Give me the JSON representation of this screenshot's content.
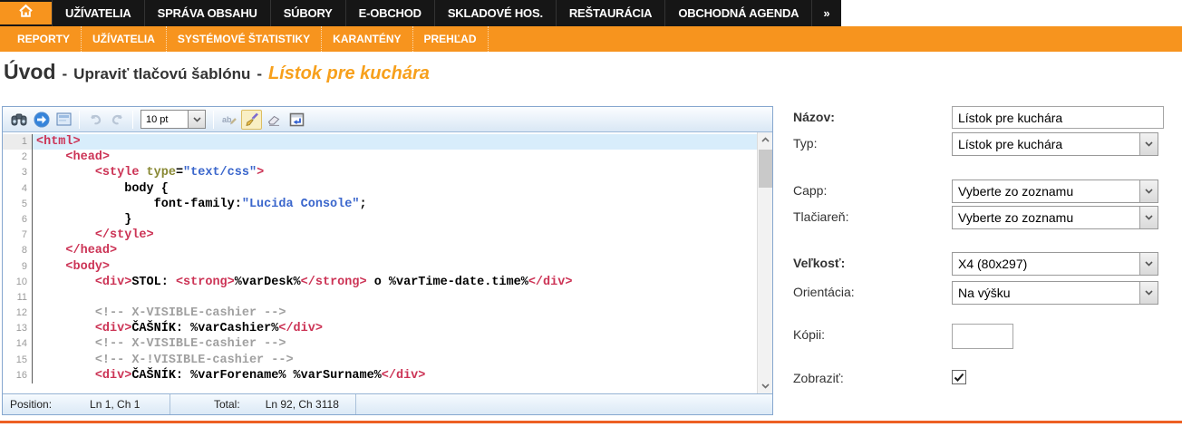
{
  "colors": {
    "orange": "#F7941E",
    "rule_orange": "#ED6023",
    "nav_black": "#161616",
    "tag_red": "#CC3355",
    "attr_olive": "#888833",
    "string_blue": "#3A66CC",
    "comment_gray": "#A0A0A0",
    "active_line_blue": "#D8EDFB"
  },
  "nav": {
    "home_icon": "home-icon",
    "items": [
      "UŽÍVATELIA",
      "SPRÁVA OBSAHU",
      "SÚBORY",
      "E-OBCHOD",
      "SKLADOVÉ HOS.",
      "REŠTAURÁCIA",
      "OBCHODNÁ AGENDA"
    ],
    "more": "»"
  },
  "subnav": {
    "items": [
      "REPORTY",
      "UŽÍVATELIA",
      "SYSTÉMOVÉ ŠTATISTIKY",
      "KARANTÉNY",
      "PREHĽAD"
    ]
  },
  "breadcrumb": {
    "root": "Úvod",
    "separator": "-",
    "section": "Upraviť tlačovú šablónu",
    "current": "Lístok pre kuchára"
  },
  "editor": {
    "toolbar": {
      "font_size": "10 pt",
      "icons": [
        "find",
        "goto-line",
        "select-all",
        "undo",
        "redo",
        "font-size-select",
        "replace",
        "format-brush",
        "eraser",
        "insert-template"
      ]
    },
    "lines": [
      {
        "no": 1,
        "active": true,
        "tokens": [
          {
            "t": "tag",
            "s": "<html>"
          }
        ]
      },
      {
        "no": 2,
        "tokens": [
          {
            "t": "text",
            "s": "    "
          },
          {
            "t": "tag",
            "s": "<head>"
          }
        ]
      },
      {
        "no": 3,
        "tokens": [
          {
            "t": "text",
            "s": "        "
          },
          {
            "t": "tag",
            "s": "<style"
          },
          {
            "t": "text",
            "s": " "
          },
          {
            "t": "attr",
            "s": "type"
          },
          {
            "t": "text",
            "s": "="
          },
          {
            "t": "str",
            "s": "\"text/css\""
          },
          {
            "t": "tag",
            "s": ">"
          }
        ]
      },
      {
        "no": 4,
        "tokens": [
          {
            "t": "text",
            "s": "            body {"
          }
        ]
      },
      {
        "no": 5,
        "tokens": [
          {
            "t": "text",
            "s": "                font-family:"
          },
          {
            "t": "str",
            "s": "\"Lucida Console\""
          },
          {
            "t": "text",
            "s": ";"
          }
        ]
      },
      {
        "no": 6,
        "tokens": [
          {
            "t": "text",
            "s": "            }"
          }
        ]
      },
      {
        "no": 7,
        "tokens": [
          {
            "t": "text",
            "s": "        "
          },
          {
            "t": "tag",
            "s": "</style>"
          }
        ]
      },
      {
        "no": 8,
        "tokens": [
          {
            "t": "text",
            "s": "    "
          },
          {
            "t": "tag",
            "s": "</head>"
          }
        ]
      },
      {
        "no": 9,
        "tokens": [
          {
            "t": "text",
            "s": "    "
          },
          {
            "t": "tag",
            "s": "<body>"
          }
        ]
      },
      {
        "no": 10,
        "tokens": [
          {
            "t": "text",
            "s": "        "
          },
          {
            "t": "tag",
            "s": "<div>"
          },
          {
            "t": "text",
            "s": "STOL: "
          },
          {
            "t": "tag",
            "s": "<strong>"
          },
          {
            "t": "text",
            "s": "%varDesk%"
          },
          {
            "t": "tag",
            "s": "</strong>"
          },
          {
            "t": "text",
            "s": " o %varTime-date.time%"
          },
          {
            "t": "tag",
            "s": "</div>"
          }
        ]
      },
      {
        "no": 11,
        "tokens": []
      },
      {
        "no": 12,
        "tokens": [
          {
            "t": "text",
            "s": "        "
          },
          {
            "t": "comment",
            "s": "<!-- X-VISIBLE-cashier -->"
          }
        ]
      },
      {
        "no": 13,
        "tokens": [
          {
            "t": "text",
            "s": "        "
          },
          {
            "t": "tag",
            "s": "<div>"
          },
          {
            "t": "text",
            "s": "ČAŠNÍK: %varCashier%"
          },
          {
            "t": "tag",
            "s": "</div>"
          }
        ]
      },
      {
        "no": 14,
        "tokens": [
          {
            "t": "text",
            "s": "        "
          },
          {
            "t": "comment",
            "s": "<!-- X-VISIBLE-cashier -->"
          }
        ]
      },
      {
        "no": 15,
        "tokens": [
          {
            "t": "text",
            "s": "        "
          },
          {
            "t": "comment",
            "s": "<!-- X-!VISIBLE-cashier -->"
          }
        ]
      },
      {
        "no": 16,
        "tokens": [
          {
            "t": "text",
            "s": "        "
          },
          {
            "t": "tag",
            "s": "<div>"
          },
          {
            "t": "text",
            "s": "ČAŠNÍK: %varForename% %varSurname%"
          },
          {
            "t": "tag",
            "s": "</div>"
          }
        ]
      }
    ],
    "status": {
      "position_label": "Position:",
      "position_value": "Ln 1, Ch 1",
      "total_label": "Total:",
      "total_value": "Ln 92, Ch 3118"
    }
  },
  "form": {
    "fields": [
      {
        "id": "nazov",
        "label": "Názov:",
        "bold": true,
        "control": "text",
        "value": "Lístok pre kuchára"
      },
      {
        "id": "typ",
        "label": "Typ:",
        "bold": false,
        "control": "select",
        "value": "Lístok pre kuchára"
      },
      {
        "id": "capp",
        "label": "Capp:",
        "bold": false,
        "control": "select",
        "value": "Vyberte zo zoznamu"
      },
      {
        "id": "tlaciaren",
        "label": "Tlačiareň:",
        "bold": false,
        "control": "select",
        "value": "Vyberte zo zoznamu"
      },
      {
        "id": "velkost",
        "label": "Veľkosť:",
        "bold": true,
        "control": "select",
        "value": "X4 (80x297)"
      },
      {
        "id": "orientacia",
        "label": "Orientácia:",
        "bold": false,
        "control": "select",
        "value": "Na výšku"
      },
      {
        "id": "kopii",
        "label": "Kópii:",
        "bold": false,
        "control": "text-small",
        "value": ""
      },
      {
        "id": "zobrazit",
        "label": "Zobraziť:",
        "bold": false,
        "control": "checkbox",
        "checked": true
      }
    ]
  }
}
